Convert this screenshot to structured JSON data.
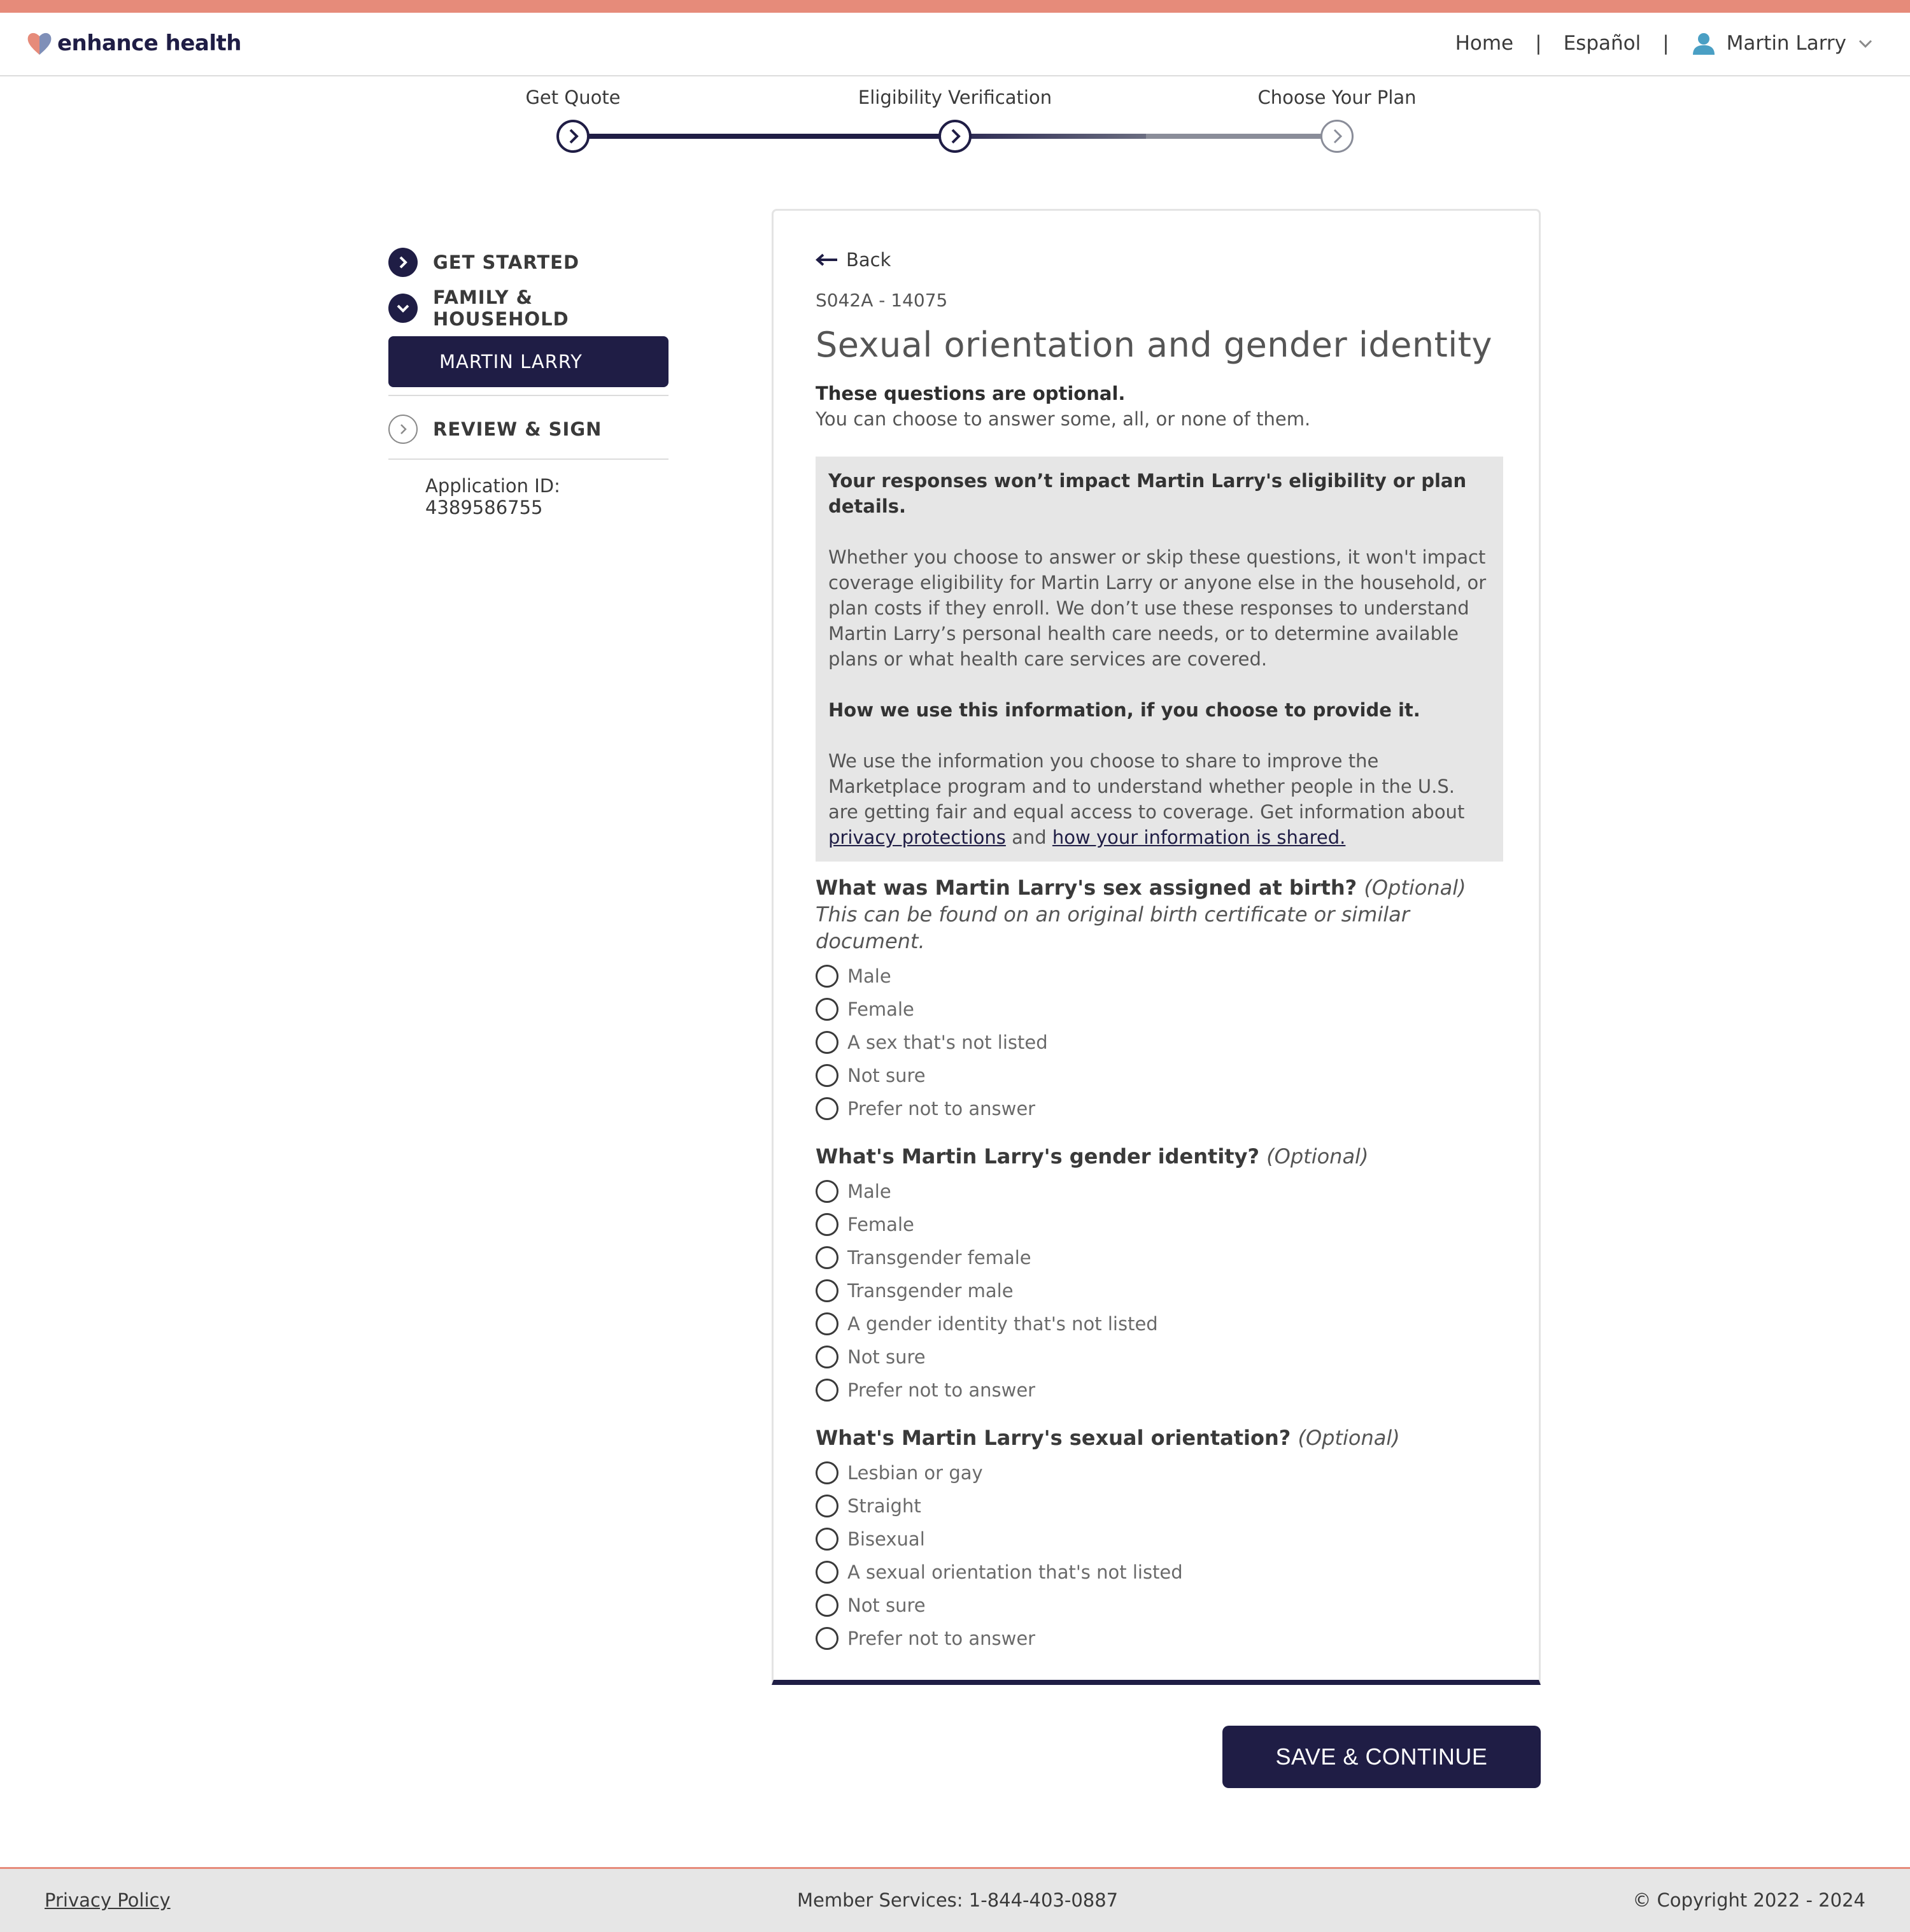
{
  "colors": {
    "brand_navy": "#1f1d45",
    "accent_coral": "#e68b7a",
    "info_box_bg": "#e6e6e6",
    "step_inactive": "#8a8d99"
  },
  "header": {
    "logo_text": "enhance health",
    "nav": {
      "home": "Home",
      "language": "Español",
      "user_name": "Martin Larry",
      "separator": "|"
    }
  },
  "stepper": {
    "steps": [
      {
        "label": "Get Quote",
        "state": "complete"
      },
      {
        "label": "Eligibility Verification",
        "state": "current"
      },
      {
        "label": "Choose Your Plan",
        "state": "upcoming"
      }
    ]
  },
  "sidebar": {
    "get_started": "GET STARTED",
    "family_household": "FAMILY & HOUSEHOLD",
    "member": "MARTIN LARRY",
    "review_sign": "REVIEW & SIGN",
    "application_id": "Application ID: 4389586755"
  },
  "form": {
    "back_label": "Back",
    "code": "S042A - 14075",
    "title": "Sexual orientation and gender identity",
    "optional_notice": "These questions are optional.",
    "optional_sub": "You can choose to answer some, all, or none of them.",
    "info": {
      "heading": "Your responses won’t impact Martin Larry's eligibility or plan details.",
      "body1": "Whether you choose to answer or skip these questions, it won't impact coverage eligibility for Martin Larry or anyone else in the household, or plan costs if they enroll. We don’t use these responses to understand Martin Larry’s personal health care needs, or to determine available plans or what health care services are covered.",
      "heading2": "How we use this information, if you choose to provide it.",
      "body2": "We use the information you choose to share to improve the Marketplace program and to understand whether people in the U.S. are getting fair and equal access to coverage. Get information about",
      "link1": "privacy protections",
      "and": "and",
      "link2": "how your information is shared."
    },
    "optional_tag": "(Optional)",
    "q1": {
      "label": "What was Martin Larry's sex assigned at birth?",
      "hint": "This can be found on an original birth certificate or similar document.",
      "options": [
        "Male",
        "Female",
        "A sex that's not listed",
        "Not sure",
        "Prefer not to answer"
      ]
    },
    "q2": {
      "label": "What's Martin Larry's gender identity?",
      "options": [
        "Male",
        "Female",
        "Transgender female",
        "Transgender male",
        "A gender identity that's not listed",
        "Not sure",
        "Prefer not to answer"
      ]
    },
    "q3": {
      "label": "What's Martin Larry's sexual orientation?",
      "options": [
        "Lesbian or gay",
        "Straight",
        "Bisexual",
        "A sexual orientation that's not listed",
        "Not sure",
        "Prefer not to answer"
      ]
    },
    "save_button": "SAVE & CONTINUE"
  },
  "footer": {
    "privacy": "Privacy Policy",
    "services": "Member Services: 1-844-403-0887",
    "copyright": "© Copyright 2022 - 2024"
  }
}
